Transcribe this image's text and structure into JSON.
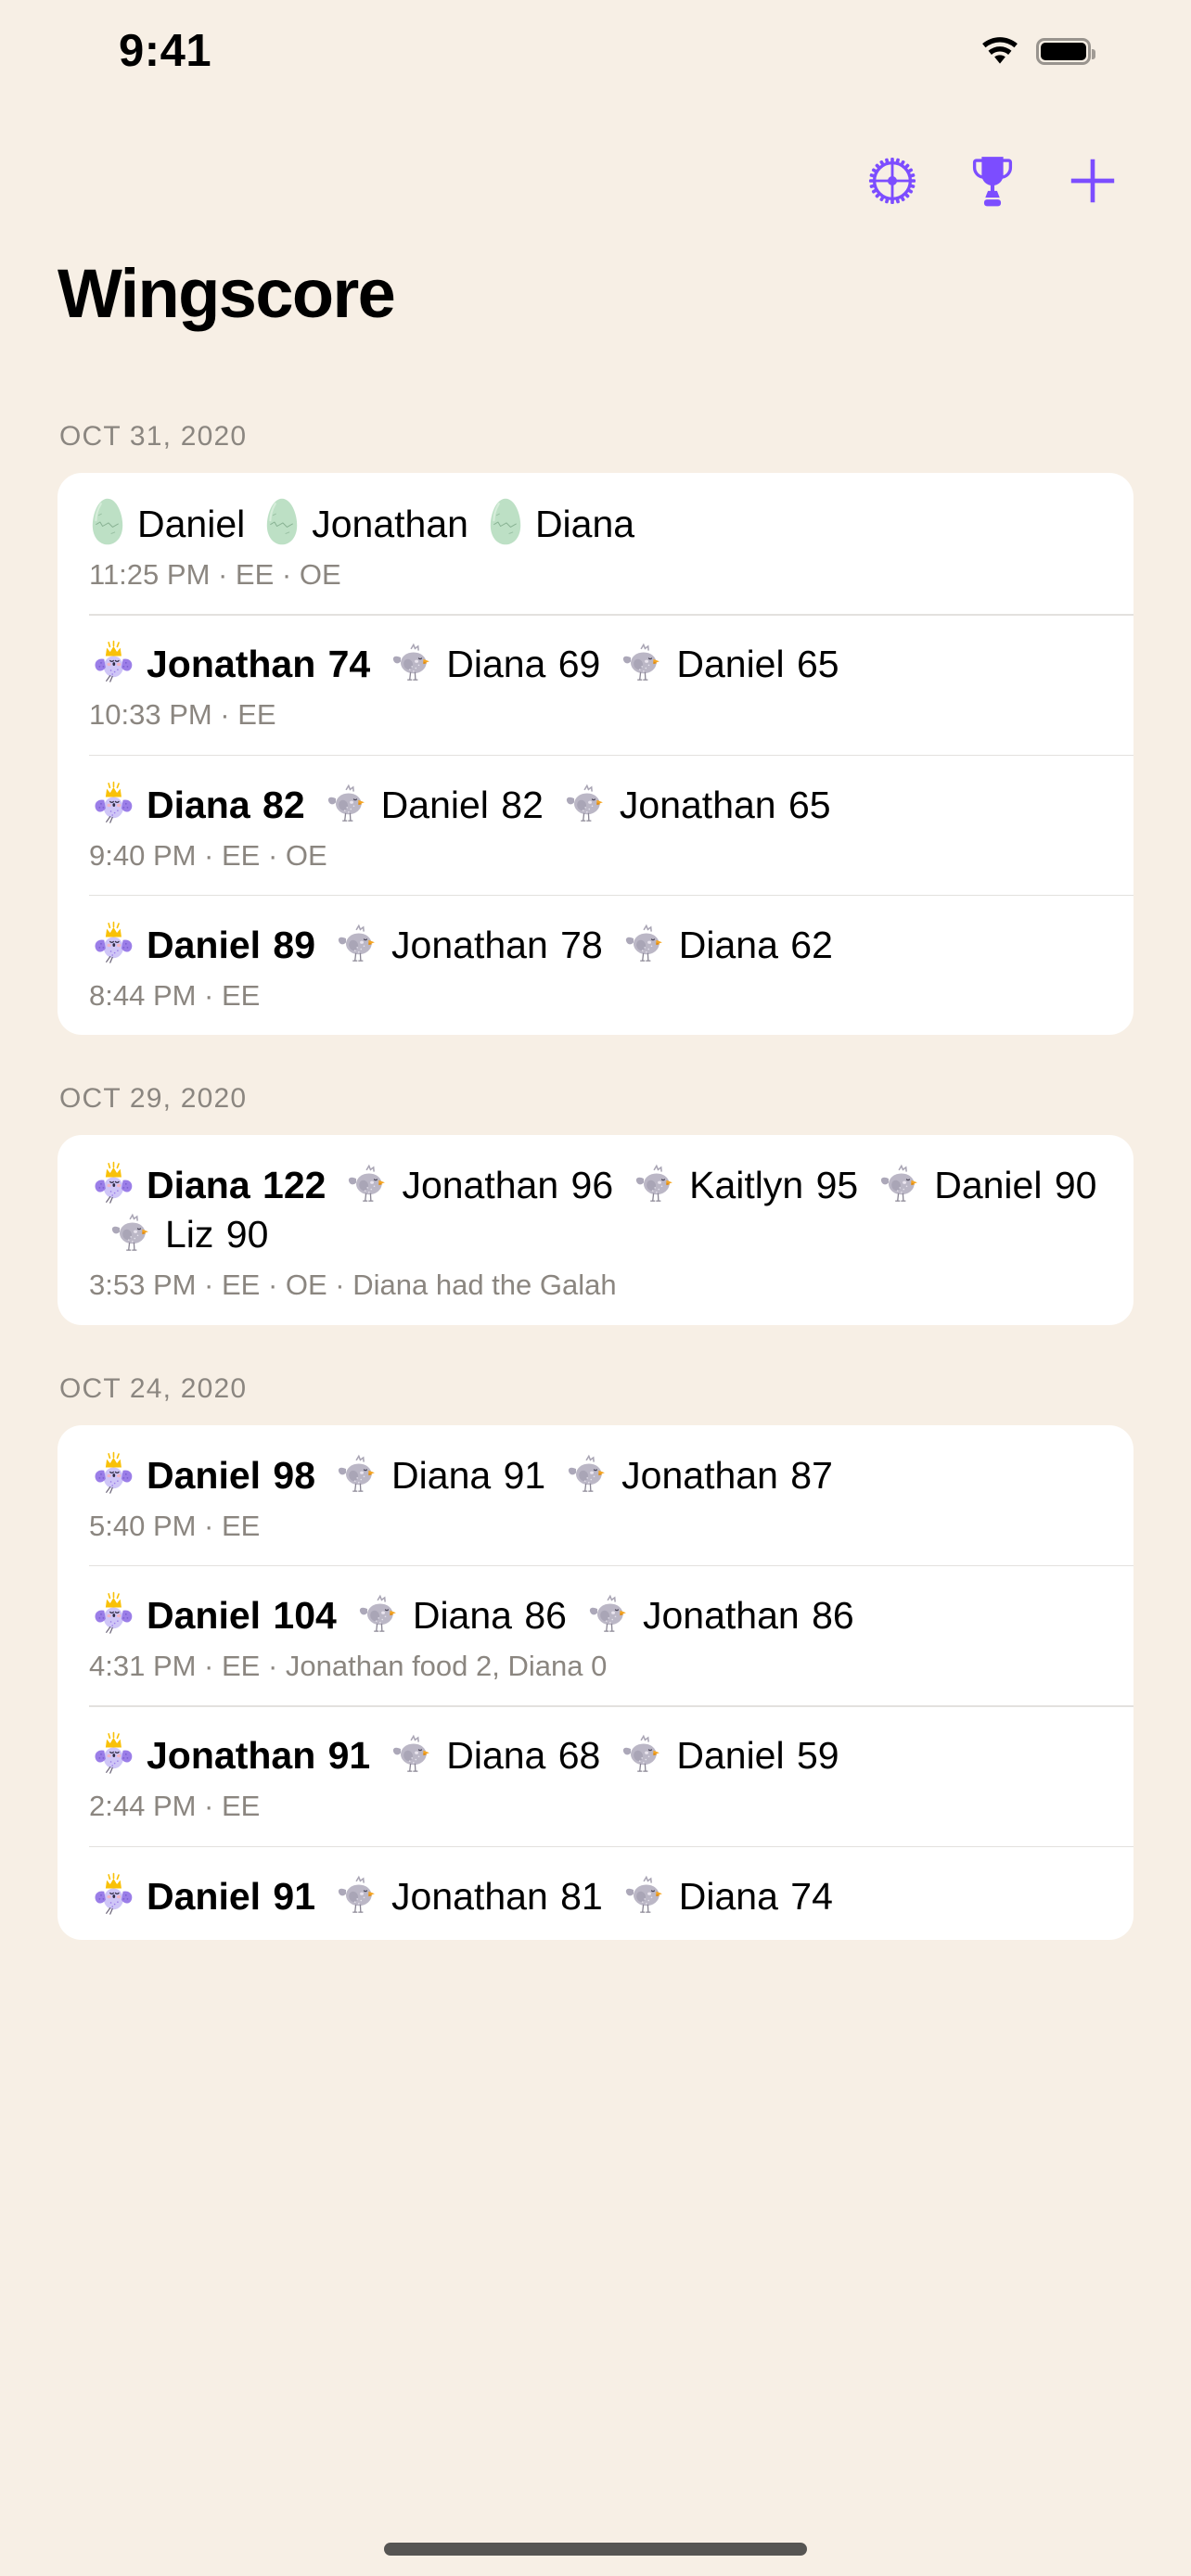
{
  "status_bar": {
    "time": "9:41",
    "wifi_icon": "wifi-icon",
    "battery_icon": "battery-full-icon"
  },
  "nav_bar": {
    "buttons": [
      {
        "name": "settings-button",
        "icon": "gear-icon",
        "label": "Settings"
      },
      {
        "name": "leaderboard-button",
        "icon": "trophy-icon",
        "label": "Leaderboard"
      },
      {
        "name": "add-game-button",
        "icon": "plus-icon",
        "label": "Add"
      }
    ],
    "accent_color": "#7C4DFF"
  },
  "page_title": "Wingscore",
  "theme": {
    "background": "#F7EFE5",
    "card_background": "#FFFFFF",
    "primary_text": "#000000",
    "secondary_text": "#8B8680",
    "accent": "#7C4DFF",
    "crown": "#F9C108",
    "winner_bird": "#B7A6F0",
    "loser_bird": "#B9B5C0",
    "egg": "#BFE0C4"
  },
  "sections": [
    {
      "date": "OCT 31, 2020",
      "games": [
        {
          "icon_type": "egg",
          "players": [
            {
              "name": "Daniel",
              "score": "",
              "winner": false
            },
            {
              "name": "Jonathan",
              "score": "",
              "winner": false
            },
            {
              "name": "Diana",
              "score": "",
              "winner": false
            }
          ],
          "meta": "11:25 PM · EE · OE"
        },
        {
          "icon_type": "bird",
          "players": [
            {
              "name": "Jonathan",
              "score": "74",
              "winner": true
            },
            {
              "name": "Diana",
              "score": "69",
              "winner": false
            },
            {
              "name": "Daniel",
              "score": "65",
              "winner": false
            }
          ],
          "meta": "10:33 PM · EE"
        },
        {
          "icon_type": "bird",
          "players": [
            {
              "name": "Diana",
              "score": "82",
              "winner": true
            },
            {
              "name": "Daniel",
              "score": "82",
              "winner": false
            },
            {
              "name": "Jonathan",
              "score": "65",
              "winner": false
            }
          ],
          "meta": "9:40 PM · EE · OE"
        },
        {
          "icon_type": "bird",
          "players": [
            {
              "name": "Daniel",
              "score": "89",
              "winner": true
            },
            {
              "name": "Jonathan",
              "score": "78",
              "winner": false
            },
            {
              "name": "Diana",
              "score": "62",
              "winner": false
            }
          ],
          "meta": "8:44 PM · EE"
        }
      ]
    },
    {
      "date": "OCT 29, 2020",
      "games": [
        {
          "icon_type": "bird",
          "players": [
            {
              "name": "Diana",
              "score": "122",
              "winner": true
            },
            {
              "name": "Jonathan",
              "score": "96",
              "winner": false
            },
            {
              "name": "Kaitlyn",
              "score": "95",
              "winner": false
            },
            {
              "name": "Daniel",
              "score": "90",
              "winner": false
            },
            {
              "name": "Liz",
              "score": "90",
              "winner": false
            }
          ],
          "meta": "3:53 PM · EE · OE · Diana had the Galah"
        }
      ]
    },
    {
      "date": "OCT 24, 2020",
      "games": [
        {
          "icon_type": "bird",
          "players": [
            {
              "name": "Daniel",
              "score": "98",
              "winner": true
            },
            {
              "name": "Diana",
              "score": "91",
              "winner": false
            },
            {
              "name": "Jonathan",
              "score": "87",
              "winner": false
            }
          ],
          "meta": "5:40 PM · EE"
        },
        {
          "icon_type": "bird",
          "players": [
            {
              "name": "Daniel",
              "score": "104",
              "winner": true
            },
            {
              "name": "Diana",
              "score": "86",
              "winner": false
            },
            {
              "name": "Jonathan",
              "score": "86",
              "winner": false
            }
          ],
          "meta": "4:31 PM · EE · Jonathan food 2, Diana 0"
        },
        {
          "icon_type": "bird",
          "players": [
            {
              "name": "Jonathan",
              "score": "91",
              "winner": true
            },
            {
              "name": "Diana",
              "score": "68",
              "winner": false
            },
            {
              "name": "Daniel",
              "score": "59",
              "winner": false
            }
          ],
          "meta": "2:44 PM · EE"
        },
        {
          "icon_type": "bird",
          "players": [
            {
              "name": "Daniel",
              "score": "91",
              "winner": true
            },
            {
              "name": "Jonathan",
              "score": "81",
              "winner": false
            },
            {
              "name": "Diana",
              "score": "74",
              "winner": false
            }
          ],
          "meta": ""
        }
      ]
    }
  ]
}
